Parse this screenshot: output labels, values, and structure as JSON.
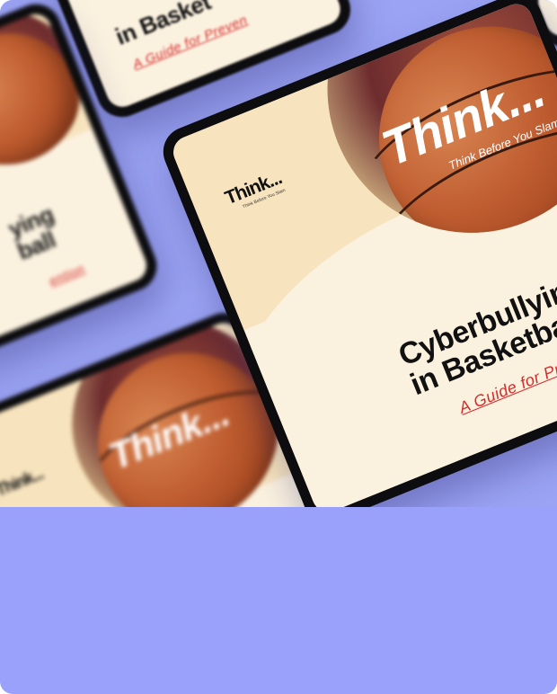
{
  "hero": {
    "background_color": "#9ba3f4",
    "footer_color": "#99a1fb"
  },
  "booklet": {
    "logo_word": "Think...",
    "logo_tagline": "Think Before You Slam",
    "ball_word": "Think...",
    "ball_tagline": "Think Before You Slam",
    "title_line1": "Cyberbullying",
    "title_line2": "in Basketball",
    "subtitle": "A Guide for Prevention",
    "accent_color": "#d62b2b"
  },
  "partial": {
    "top_title": "in Basket",
    "top_subtitle": "A Guide for Preven",
    "left_title_1": "ying",
    "left_title_2": "ball",
    "left_subtitle": "ention"
  }
}
